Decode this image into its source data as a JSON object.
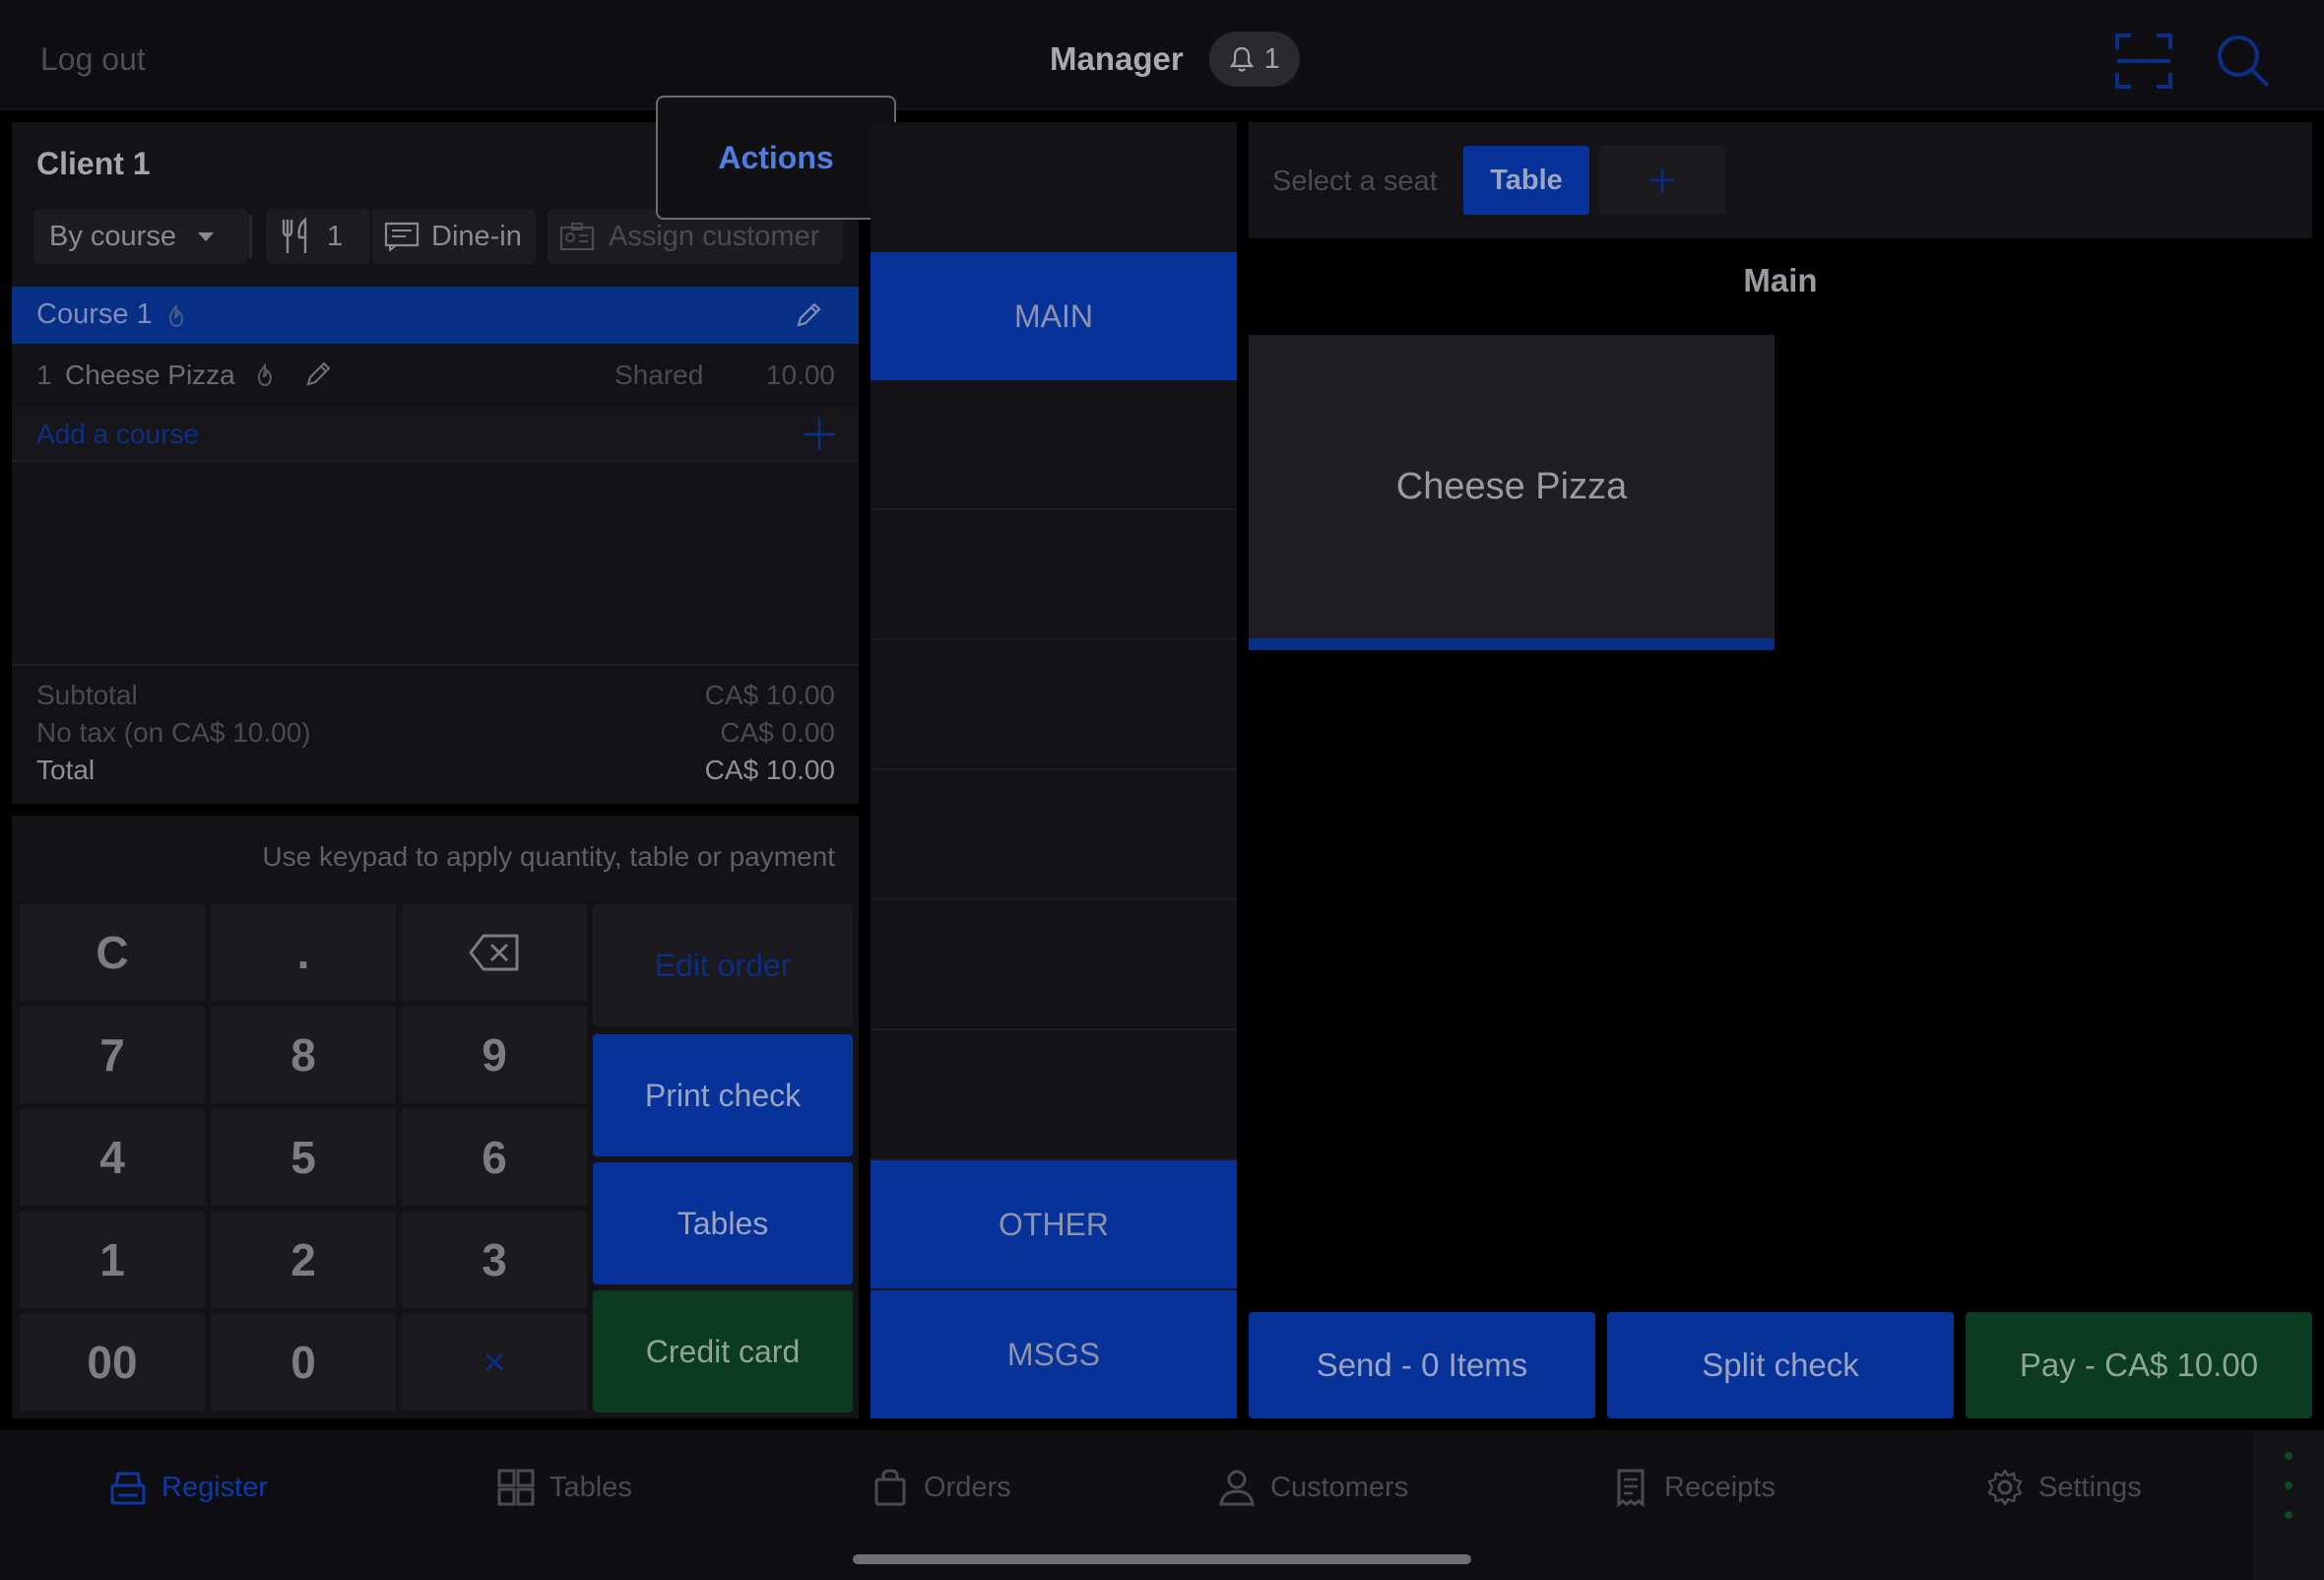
{
  "header": {
    "logout": "Log out",
    "title": "Manager",
    "notification_count": "1"
  },
  "order": {
    "client": "Client 1",
    "actions": "Actions",
    "by_course": "By course",
    "guests": "1",
    "dine_in": "Dine-in",
    "assign_customer": "Assign customer",
    "course_label": "Course 1",
    "item": {
      "qty": "1",
      "name": "Cheese Pizza",
      "shared": "Shared",
      "price": "10.00"
    },
    "add_course": "Add a course",
    "totals": {
      "subtotal_label": "Subtotal",
      "subtotal_value": "CA$ 10.00",
      "tax_label": "No tax (on CA$ 10.00)",
      "tax_value": "CA$ 0.00",
      "total_label": "Total",
      "total_value": "CA$ 10.00"
    }
  },
  "keypad": {
    "hint": "Use keypad to apply quantity, table or payment",
    "keys": [
      "C",
      ".",
      "⌫",
      "7",
      "8",
      "9",
      "4",
      "5",
      "6",
      "1",
      "2",
      "3",
      "00",
      "0",
      "×"
    ],
    "edit_order": "Edit order",
    "print_check": "Print check",
    "tables": "Tables",
    "credit_card": "Credit card"
  },
  "categories": {
    "main": "MAIN",
    "other": "OTHER",
    "msgs": "MSGS"
  },
  "seats": {
    "label": "Select a seat",
    "table": "Table",
    "add": "+"
  },
  "menu": {
    "section_title": "Main",
    "product": "Cheese Pizza"
  },
  "bottom_actions": {
    "send": "Send - 0 Items",
    "split": "Split check",
    "pay": "Pay - CA$ 10.00"
  },
  "tabs": {
    "register": "Register",
    "tables": "Tables",
    "orders": "Orders",
    "customers": "Customers",
    "receipts": "Receipts",
    "settings": "Settings"
  },
  "colors": {
    "accent_blue": "#07329a",
    "accent_green": "#0b3b20",
    "link_blue": "#4f7ee0"
  }
}
